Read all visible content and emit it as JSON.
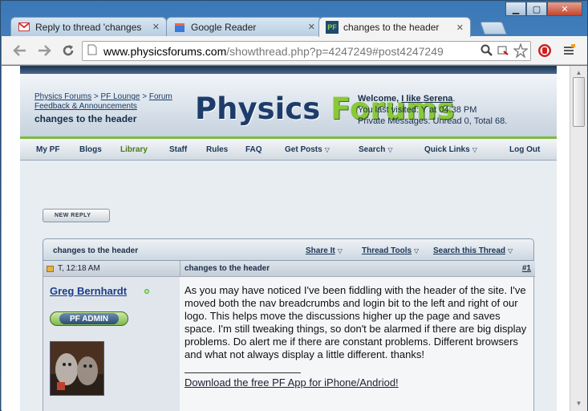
{
  "window": {
    "controls": {
      "minimize": "▁",
      "maximize": "▢",
      "close": "✕"
    }
  },
  "tabs": [
    {
      "label": "Reply to thread 'changes",
      "icon": "gmail-icon"
    },
    {
      "label": "Google Reader",
      "icon": "google-reader-icon"
    },
    {
      "label": "changes to the header",
      "icon": "pf-icon",
      "active": true
    }
  ],
  "tab_close": "✕",
  "toolbar": {
    "url_host": "www.physicsforums.com",
    "url_path": "/showthread.php?p=4247249#post4247249"
  },
  "site": {
    "breadcrumbs": [
      "Physics Forums",
      ">",
      "PF Lounge",
      ">",
      "Forum",
      "Feedback & Announcements"
    ],
    "current": "changes to the header",
    "logo_part1": "Physics ",
    "logo_part2": "Forums",
    "welcome_prefix": "Welcome,",
    "welcome_user": "I like Serena",
    "welcome_suffix": ".",
    "last_visited": "You last visited: Y at 04:38 PM",
    "private_messages": "Private Messages: Unread 0, Total 68."
  },
  "nav": [
    "My PF",
    "Blogs",
    "Library",
    "Staff",
    "Rules",
    "FAQ",
    "Get Posts",
    "Search",
    "Quick Links",
    "Log Out"
  ],
  "thread": {
    "reply_button": "NEW REPLY",
    "title": "changes to the header",
    "share": "Share It",
    "tools": "Thread Tools",
    "search": "Search this Thread"
  },
  "post": {
    "date": "T, 12:18 AM",
    "subject": "changes to the header",
    "number": "#1",
    "author": "Greg Bernhardt",
    "badge": "PF ADMIN",
    "body": "As you may have noticed I've been fiddling with the header of the site. I've moved both the nav breadcrumbs and login bit to the left and right of our logo. This helps move the discussions higher up the page and saves space. I'm still tweaking things, so don't be alarmed if there are big display problems. Do alert me if there are constant problems. Different browsers and what not always display a little different. thanks!",
    "signature": "Download the free PF App for iPhone/Andriod!"
  }
}
